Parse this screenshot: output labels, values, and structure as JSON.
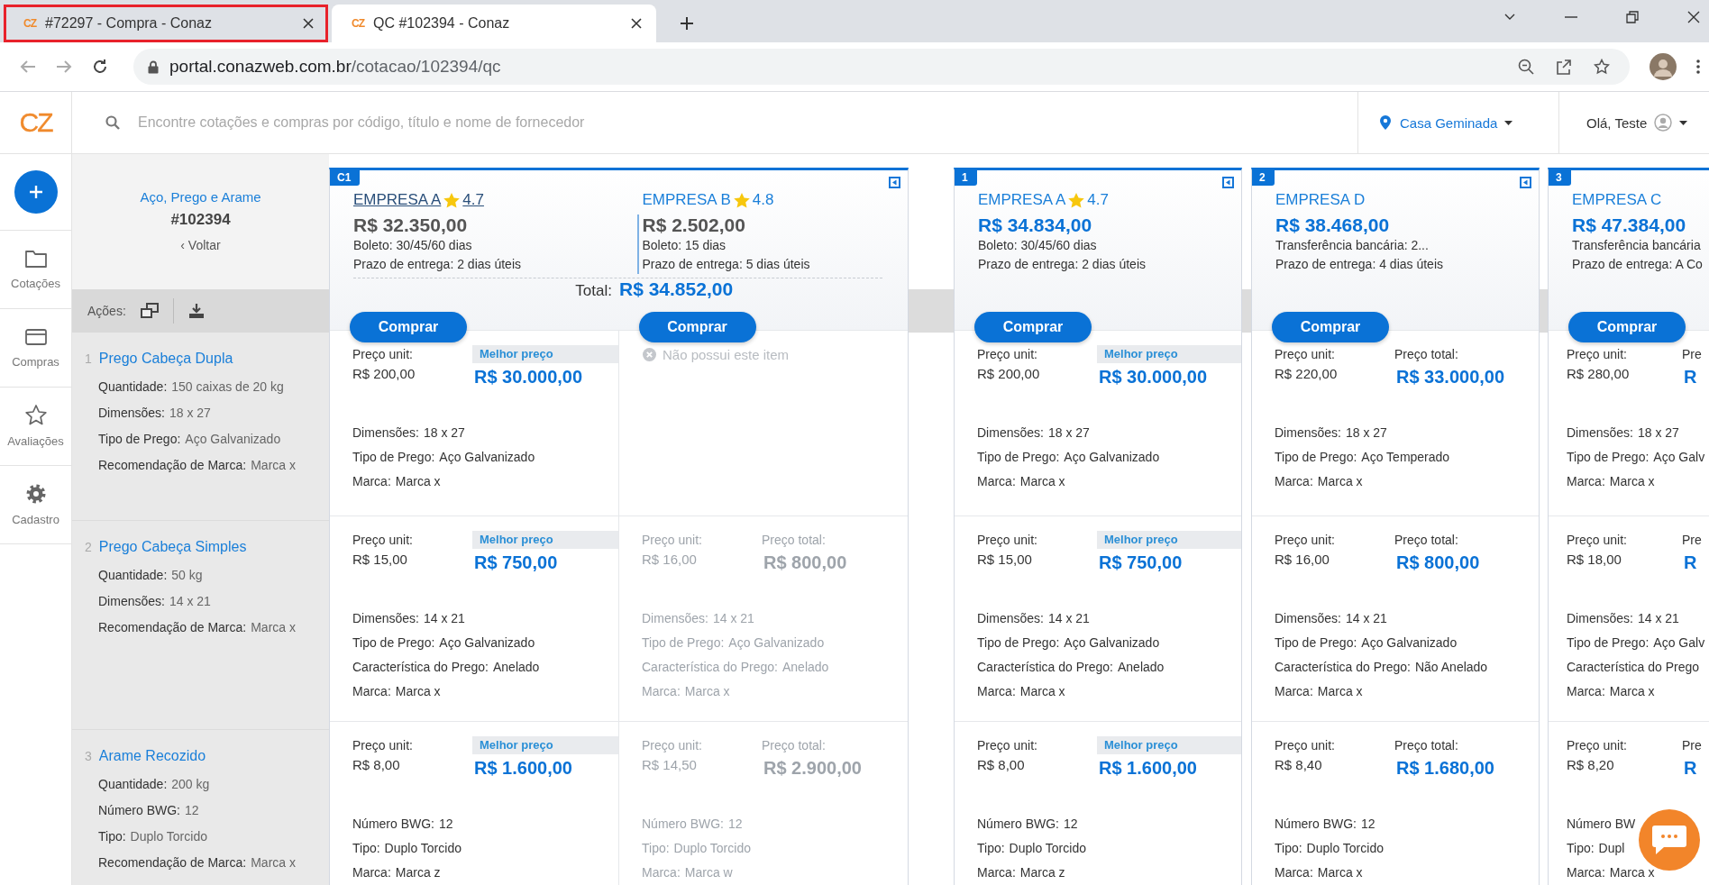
{
  "browser": {
    "tabs": [
      {
        "favicon": "CZ",
        "title": "#72297 - Compra - Conaz",
        "selected": false,
        "highlighted": true
      },
      {
        "favicon": "CZ",
        "title": "QC #102394 - Conaz",
        "selected": true,
        "highlighted": false
      }
    ],
    "url_host": "portal.conazweb.com.br",
    "url_path": "/cotacao/102394/qc"
  },
  "app": {
    "logo": "CZ",
    "search_placeholder": "Encontre cotações e compras por código, título e nome de fornecedor",
    "location": "Casa Geminada",
    "greeting": "Olá, Teste"
  },
  "nav": {
    "items": [
      {
        "kind": "folder",
        "label": "Cotações"
      },
      {
        "kind": "card",
        "label": "Compras"
      },
      {
        "kind": "star",
        "label": "Avaliações"
      },
      {
        "kind": "gear",
        "label": "Cadastro"
      }
    ]
  },
  "quote": {
    "title": "Aço, Prego e Arame",
    "code": "#102394",
    "back": "‹ Voltar",
    "actions_label": "Ações:",
    "items": [
      {
        "number": "1",
        "name": "Prego Cabeça Dupla",
        "specs": [
          {
            "label": "Quantidade:",
            "value": "150 caixas de 20 kg"
          },
          {
            "label": "Dimensões:",
            "value": "18 x 27"
          },
          {
            "label": "Tipo de Prego:",
            "value": "Aço Galvanizado"
          },
          {
            "label": "Recomendação de Marca:",
            "value": "Marca x"
          }
        ]
      },
      {
        "number": "2",
        "name": "Prego Cabeça Simples",
        "specs": [
          {
            "label": "Quantidade:",
            "value": "50 kg"
          },
          {
            "label": "Dimensões:",
            "value": "14 x 21"
          },
          {
            "label": "Recomendação de Marca:",
            "value": "Marca x"
          }
        ]
      },
      {
        "number": "3",
        "name": "Arame Recozido",
        "specs": [
          {
            "label": "Quantidade:",
            "value": "200 kg"
          },
          {
            "label": "Número BWG:",
            "value": "12"
          },
          {
            "label": "Tipo:",
            "value": "Duplo Torcido"
          },
          {
            "label": "Recomendação de Marca:",
            "value": "Marca x"
          }
        ]
      }
    ]
  },
  "cards": [
    {
      "badge": "C1",
      "kind": "combined",
      "collapse_icon": true,
      "total_label": "Total:",
      "total": "R$ 34.852,00",
      "suppliers": [
        {
          "name": "EMPRESA A",
          "rating": "4.7",
          "underlined": true,
          "price": "R$ 32.350,00",
          "payment": "Boleto: 30/45/60 dias",
          "delivery_label": "Prazo de entrega:",
          "delivery": "2 dias úteis",
          "button": "Comprar",
          "cells": [
            {
              "kind": "quote",
              "dimmed": false,
              "best": true,
              "unit_label": "Preço unit:",
              "unit": "R$ 200,00",
              "total_label": "Melhor preço",
              "total": "R$ 30.000,00",
              "specs": [
                {
                  "label": "Dimensões:",
                  "value": "18 x 27"
                },
                {
                  "label": "Tipo de Prego:",
                  "value": "Aço Galvanizado"
                },
                {
                  "label": "Marca:",
                  "value": "Marca x"
                }
              ]
            },
            {
              "kind": "quote",
              "dimmed": false,
              "best": true,
              "unit_label": "Preço unit:",
              "unit": "R$ 15,00",
              "total_label": "Melhor preço",
              "total": "R$ 750,00",
              "specs": [
                {
                  "label": "Dimensões:",
                  "value": "14 x 21"
                },
                {
                  "label": "Tipo de Prego:",
                  "value": "Aço Galvanizado"
                },
                {
                  "label": "Característica do Prego:",
                  "value": "Anelado"
                },
                {
                  "label": "Marca:",
                  "value": "Marca x"
                }
              ]
            },
            {
              "kind": "quote",
              "dimmed": false,
              "best": true,
              "unit_label": "Preço unit:",
              "unit": "R$ 8,00",
              "total_label": "Melhor preço",
              "total": "R$ 1.600,00",
              "specs": [
                {
                  "label": "Número BWG:",
                  "value": "12"
                },
                {
                  "label": "Tipo:",
                  "value": "Duplo Torcido"
                },
                {
                  "label": "Marca:",
                  "value": "Marca z"
                }
              ]
            }
          ]
        },
        {
          "name": "EMPRESA B",
          "rating": "4.8",
          "underlined": false,
          "price": "R$ 2.502,00",
          "payment": "Boleto: 15 dias",
          "delivery_label": "Prazo de entrega:",
          "delivery": "5 dias úteis",
          "button": "Comprar",
          "cells": [
            {
              "kind": "missing",
              "text": "Não possui este item"
            },
            {
              "kind": "quote",
              "dimmed": true,
              "best": false,
              "unit_label": "Preço unit:",
              "unit": "R$ 16,00",
              "total_label": "Preço total:",
              "total": "R$ 800,00",
              "specs": [
                {
                  "label": "Dimensões:",
                  "value": "14 x 21"
                },
                {
                  "label": "Tipo de Prego:",
                  "value": "Aço Galvanizado"
                },
                {
                  "label": "Característica do Prego:",
                  "value": "Anelado"
                },
                {
                  "label": "Marca:",
                  "value": "Marca x"
                }
              ]
            },
            {
              "kind": "quote",
              "dimmed": true,
              "best": false,
              "unit_label": "Preço unit:",
              "unit": "R$ 14,50",
              "total_label": "Preço total:",
              "total": "R$ 2.900,00",
              "specs": [
                {
                  "label": "Número BWG:",
                  "value": "12"
                },
                {
                  "label": "Tipo:",
                  "value": "Duplo Torcido"
                },
                {
                  "label": "Marca:",
                  "value": "Marca w"
                }
              ]
            }
          ]
        }
      ]
    },
    {
      "badge": "1",
      "kind": "single",
      "collapse_icon": true,
      "suppliers": [
        {
          "name": "EMPRESA A",
          "rating": "4.7",
          "underlined": false,
          "price": "R$ 34.834,00",
          "payment": "Boleto: 30/45/60 dias",
          "delivery_label": "Prazo de entrega:",
          "delivery": "2 dias úteis",
          "button": "Comprar",
          "cells": [
            {
              "kind": "quote",
              "dimmed": false,
              "best": true,
              "unit_label": "Preço unit:",
              "unit": "R$ 200,00",
              "total_label": "Melhor preço",
              "total": "R$ 30.000,00",
              "specs": [
                {
                  "label": "Dimensões:",
                  "value": "18 x 27"
                },
                {
                  "label": "Tipo de Prego:",
                  "value": "Aço Galvanizado"
                },
                {
                  "label": "Marca:",
                  "value": "Marca x"
                }
              ]
            },
            {
              "kind": "quote",
              "dimmed": false,
              "best": true,
              "unit_label": "Preço unit:",
              "unit": "R$ 15,00",
              "total_label": "Melhor preço",
              "total": "R$ 750,00",
              "specs": [
                {
                  "label": "Dimensões:",
                  "value": "14 x 21"
                },
                {
                  "label": "Tipo de Prego:",
                  "value": "Aço Galvanizado"
                },
                {
                  "label": "Característica do Prego:",
                  "value": "Anelado"
                },
                {
                  "label": "Marca:",
                  "value": "Marca x"
                }
              ]
            },
            {
              "kind": "quote",
              "dimmed": false,
              "best": true,
              "unit_label": "Preço unit:",
              "unit": "R$ 8,00",
              "total_label": "Melhor preço",
              "total": "R$ 1.600,00",
              "specs": [
                {
                  "label": "Número BWG:",
                  "value": "12"
                },
                {
                  "label": "Tipo:",
                  "value": "Duplo Torcido"
                },
                {
                  "label": "Marca:",
                  "value": "Marca z"
                }
              ]
            }
          ]
        }
      ]
    },
    {
      "badge": "2",
      "kind": "single",
      "collapse_icon": true,
      "suppliers": [
        {
          "name": "EMPRESA D",
          "underlined": false,
          "price": "R$ 38.468,00",
          "payment": "Transferência bancária: 2...",
          "delivery_label": "Prazo de entrega:",
          "delivery": "4 dias úteis",
          "button": "Comprar",
          "cells": [
            {
              "kind": "quote",
              "dimmed": false,
              "best": false,
              "unit_label": "Preço unit:",
              "unit": "R$ 220,00",
              "total_label": "Preço total:",
              "total": "R$ 33.000,00",
              "specs": [
                {
                  "label": "Dimensões:",
                  "value": "18 x 27"
                },
                {
                  "label": "Tipo de Prego:",
                  "value": "Aço Temperado"
                },
                {
                  "label": "Marca:",
                  "value": "Marca x"
                }
              ]
            },
            {
              "kind": "quote",
              "dimmed": false,
              "best": false,
              "unit_label": "Preço unit:",
              "unit": "R$ 16,00",
              "total_label": "Preço total:",
              "total": "R$ 800,00",
              "specs": [
                {
                  "label": "Dimensões:",
                  "value": "14 x 21"
                },
                {
                  "label": "Tipo de Prego:",
                  "value": "Aço Galvanizado"
                },
                {
                  "label": "Característica do Prego:",
                  "value": "Não Anelado"
                },
                {
                  "label": "Marca:",
                  "value": "Marca x"
                }
              ]
            },
            {
              "kind": "quote",
              "dimmed": false,
              "best": false,
              "unit_label": "Preço unit:",
              "unit": "R$ 8,40",
              "total_label": "Preço total:",
              "total": "R$ 1.680,00",
              "specs": [
                {
                  "label": "Número BWG:",
                  "value": "12"
                },
                {
                  "label": "Tipo:",
                  "value": "Duplo Torcido"
                },
                {
                  "label": "Marca:",
                  "value": "Marca x"
                }
              ]
            }
          ]
        }
      ]
    },
    {
      "badge": "3",
      "kind": "single",
      "collapse_icon": false,
      "suppliers": [
        {
          "name": "EMPRESA C",
          "underlined": false,
          "price": "R$ 47.384,00",
          "payment": "Transferência bancária",
          "delivery_label": "Prazo de entrega:",
          "delivery": "A Co",
          "button": "Comprar",
          "cells": [
            {
              "kind": "quote",
              "dimmed": false,
              "best": false,
              "unit_label": "Preço unit:",
              "unit": "R$ 280,00",
              "total_label": "Pre",
              "total": "R",
              "specs": [
                {
                  "label": "Dimensões:",
                  "value": "18 x 27"
                },
                {
                  "label": "Tipo de Prego:",
                  "value": "Aço Galv"
                },
                {
                  "label": "Marca:",
                  "value": "Marca x"
                }
              ]
            },
            {
              "kind": "quote",
              "dimmed": false,
              "best": false,
              "unit_label": "Preço unit:",
              "unit": "R$ 18,00",
              "total_label": "Pre",
              "total": "R",
              "specs": [
                {
                  "label": "Dimensões:",
                  "value": "14 x 21"
                },
                {
                  "label": "Tipo de Prego:",
                  "value": "Aço Galv"
                },
                {
                  "label": "Característica do Prego"
                },
                {
                  "label": "Marca:",
                  "value": "Marca x"
                }
              ]
            },
            {
              "kind": "quote",
              "dimmed": false,
              "best": false,
              "unit_label": "Preço unit:",
              "unit": "R$ 8,20",
              "total_label": "Pre",
              "total": "R",
              "specs": [
                {
                  "label": "Número BW"
                },
                {
                  "label": "Tipo:",
                  "value": "Dupl"
                },
                {
                  "label": "Marca:",
                  "value": "Marca x"
                }
              ]
            }
          ]
        }
      ]
    }
  ]
}
